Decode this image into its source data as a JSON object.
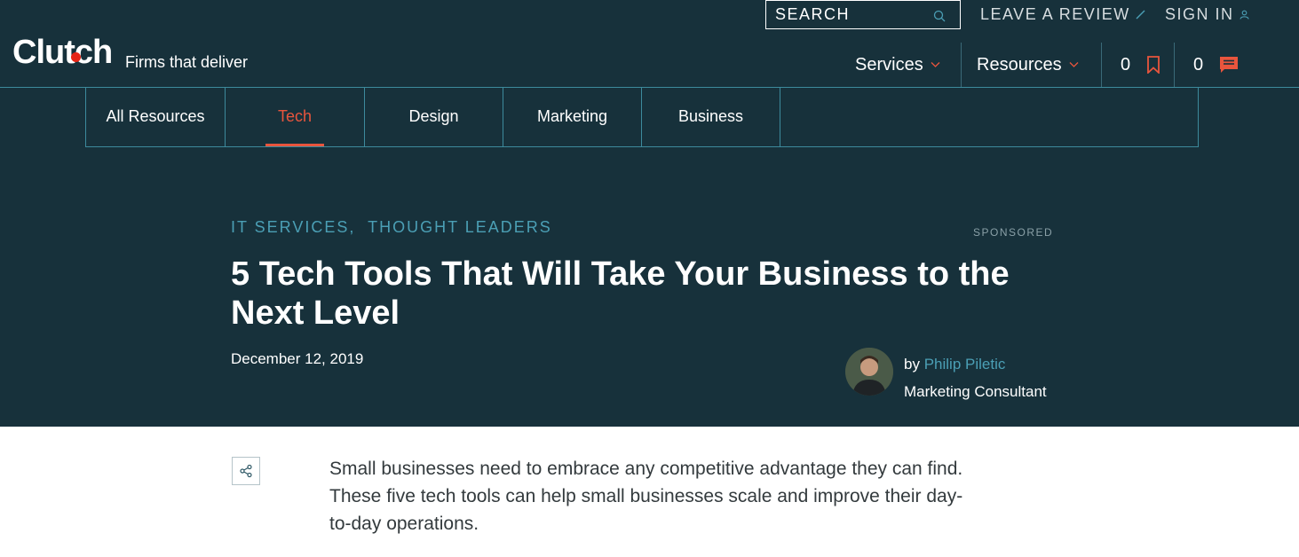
{
  "brand": {
    "logo": "Clutch",
    "tagline": "Firms that deliver",
    "accent": "#e62415"
  },
  "topbar": {
    "search_placeholder": "SEARCH",
    "leave_review": "LEAVE A REVIEW",
    "sign_in": "SIGN IN"
  },
  "mainnav": {
    "services": "Services",
    "resources": "Resources",
    "saved_count": "0",
    "messages_count": "0"
  },
  "tabs": [
    {
      "label": "All Resources",
      "active": false
    },
    {
      "label": "Tech",
      "active": true
    },
    {
      "label": "Design",
      "active": false
    },
    {
      "label": "Marketing",
      "active": false
    },
    {
      "label": "Business",
      "active": false
    }
  ],
  "article": {
    "categories": [
      "IT SERVICES,",
      "THOUGHT LEADERS"
    ],
    "sponsored": "SPONSORED",
    "title": "5 Tech Tools That Will Take Your Business to the Next Level",
    "date": "December 12, 2019",
    "author_prefix": "by",
    "author_name": "Philip Piletic",
    "author_role": "Marketing Consultant",
    "intro": "Small businesses need to embrace any competitive advantage they can find. These five tech tools can help small businesses scale and improve their day-to-day operations."
  }
}
